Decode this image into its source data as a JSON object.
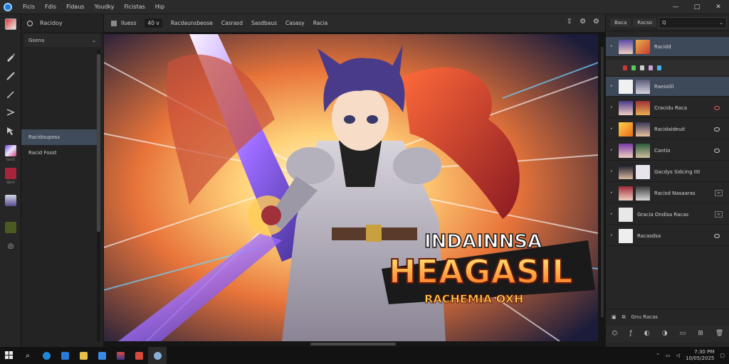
{
  "menubar": {
    "items": [
      "Ficis",
      "Fdis",
      "Fidaus",
      "Youdky",
      "Ficistas",
      "Hip"
    ],
    "window_controls": [
      "—",
      "□",
      "✕"
    ]
  },
  "toolbar": {
    "tools": [
      "brush-icon",
      "pen-icon",
      "pencil-icon",
      "lasso-icon",
      "select-icon"
    ],
    "captions": [
      "Gsr3",
      "Gkrli"
    ]
  },
  "side_panel": {
    "header_label": "Racidoy",
    "select_value": "Gsena",
    "items": [
      {
        "label": "Racidouposs",
        "active": true
      },
      {
        "label": "Racid Fosst",
        "active": false
      }
    ]
  },
  "options_bar": {
    "items": [
      "Iluess",
      "Racdaunsbeose",
      "Casrasd",
      "Sasdbaus",
      "Casasy",
      "Racia"
    ],
    "size_value": "40 v"
  },
  "canvas": {
    "title_line1": "INDAINNSA",
    "title_line2": "HEAGASIL",
    "title_line3": "RACHEMIA OXH"
  },
  "layers_panel": {
    "tabs": [
      "Baca",
      "Racso"
    ],
    "search_placeholder": "Q",
    "layers": [
      {
        "name": "Racidd",
        "selected": true
      },
      {
        "name": "Raeioilil",
        "selected": true
      },
      {
        "name": "Cracidu Raca",
        "selected": false
      },
      {
        "name": "Racidaideuit",
        "selected": false
      },
      {
        "name": "Cantio",
        "selected": false
      },
      {
        "name": "Gacdys Sidcing IIII",
        "selected": false
      },
      {
        "name": "Racisd Nasaaras",
        "selected": false
      },
      {
        "name": "Gracia Ondisa Racas",
        "selected": false
      },
      {
        "name": "Racasdsa",
        "selected": false
      }
    ],
    "footer_label": "Gnu Racas"
  },
  "taskbar": {
    "time": "7:30 PM",
    "date": "10/05/2025"
  }
}
